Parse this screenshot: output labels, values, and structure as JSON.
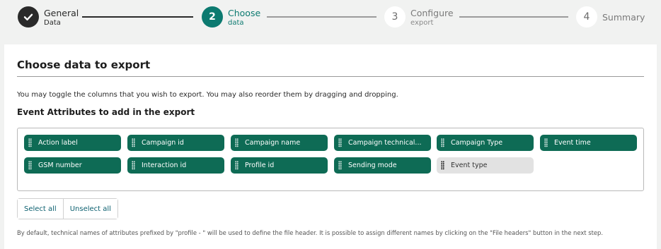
{
  "stepper": {
    "steps": [
      {
        "number": "",
        "title": "General",
        "subtitle": "Data",
        "state": "done"
      },
      {
        "number": "2",
        "title": "Choose",
        "subtitle": "data",
        "state": "active"
      },
      {
        "number": "3",
        "title": "Configure",
        "subtitle": "export",
        "state": "todo"
      },
      {
        "number": "4",
        "title": "Summary",
        "subtitle": "",
        "state": "todo"
      }
    ]
  },
  "panel": {
    "title": "Choose data to export",
    "intro": "You may toggle the columns that you wish to export. You may also reorder them by dragging and dropping.",
    "section_title": "Event Attributes to add in the export"
  },
  "chips": [
    {
      "label": "Action label",
      "selected": true
    },
    {
      "label": "Campaign id",
      "selected": true
    },
    {
      "label": "Campaign name",
      "selected": true
    },
    {
      "label": "Campaign technical...",
      "selected": true
    },
    {
      "label": "Campaign Type",
      "selected": true
    },
    {
      "label": "Event time",
      "selected": true
    },
    {
      "label": "GSM number",
      "selected": true
    },
    {
      "label": "Interaction id",
      "selected": true
    },
    {
      "label": "Profile id",
      "selected": true
    },
    {
      "label": "Sending mode",
      "selected": true
    },
    {
      "label": "Event type",
      "selected": false
    }
  ],
  "buttons": {
    "select_all": "Select all",
    "unselect_all": "Unselect all"
  },
  "footnote": "By default, technical names of attributes prefixed by \"profile - \" will be used to define the file header. It is possible to assign different names by clicking on the \"File headers\" button in the next step.",
  "colors": {
    "accent": "#0c7a70",
    "chip_selected": "#0e6b55",
    "chip_unselected": "#e2e2e2",
    "done": "#2a2a2a"
  }
}
